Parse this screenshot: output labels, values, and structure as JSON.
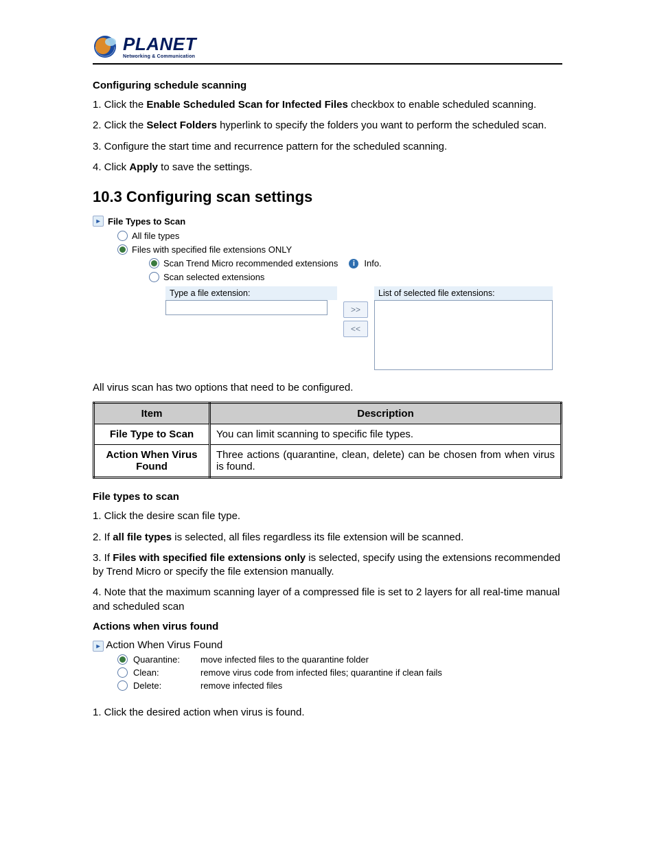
{
  "logo": {
    "brand": "PLANET",
    "tagline": "Networking & Communication"
  },
  "sec1": {
    "title": "Configuring schedule scanning",
    "steps": {
      "s1a": "1. Click the ",
      "s1b": "Enable Scheduled Scan for Infected Files",
      "s1c": " checkbox to enable scheduled scanning.",
      "s2a": "2. Click the ",
      "s2b": "Select Folders",
      "s2c": " hyperlink to specify the folders you want to perform the scheduled scan.",
      "s3": "3. Configure the start time and recurrence pattern for the scheduled scanning.",
      "s4a": "4. Click ",
      "s4b": "Apply",
      "s4c": " to save the settings."
    }
  },
  "heading103": "10.3 Configuring scan settings",
  "fts": {
    "panel": "File Types to Scan",
    "opt_all": "All file types",
    "opt_spec": "Files with specified file extensions ONLY",
    "sub_rec": "Scan Trend Micro recommended extensions",
    "sub_sel": "Scan selected extensions",
    "info": "Info.",
    "type_label": "Type a file extension:",
    "list_label": "List of selected file extensions:",
    "btn_add": ">>",
    "btn_remove": "<<"
  },
  "intro_after_fts": "All virus scan has two options that need to be configured.",
  "table": {
    "h1": "Item",
    "h2": "Description",
    "r1_item": "File Type to Scan",
    "r1_desc": "You can limit scanning to specific file types.",
    "r2_item": "Action When Virus Found",
    "r2_desc": "Three actions (quarantine, clean, delete) can be chosen from when virus is found."
  },
  "ftts": {
    "title": "File types to scan",
    "s1": "1. Click the desire scan file type.",
    "s2a": "2. If ",
    "s2b": "all file types",
    "s2c": " is selected, all files regardless its file extension will be scanned.",
    "s3a": "3. If ",
    "s3b": "Files with specified file extensions only",
    "s3c": " is selected, specify using the extensions recommended by Trend Micro or specify the file extension manually.",
    "s4": "4. Note that the maximum scanning layer of a compressed file is set to 2 layers for all real-time manual and scheduled scan"
  },
  "awvf": {
    "title": "Actions when virus found",
    "panel": "Action When Virus Found",
    "rows": [
      {
        "label": "Quarantine:",
        "desc": "move infected files to the quarantine folder"
      },
      {
        "label": "Clean:",
        "desc": "remove virus code from infected files; quarantine if clean fails"
      },
      {
        "label": "Delete:",
        "desc": "remove infected files"
      }
    ],
    "step1": "1. Click the desired action when virus is found."
  }
}
